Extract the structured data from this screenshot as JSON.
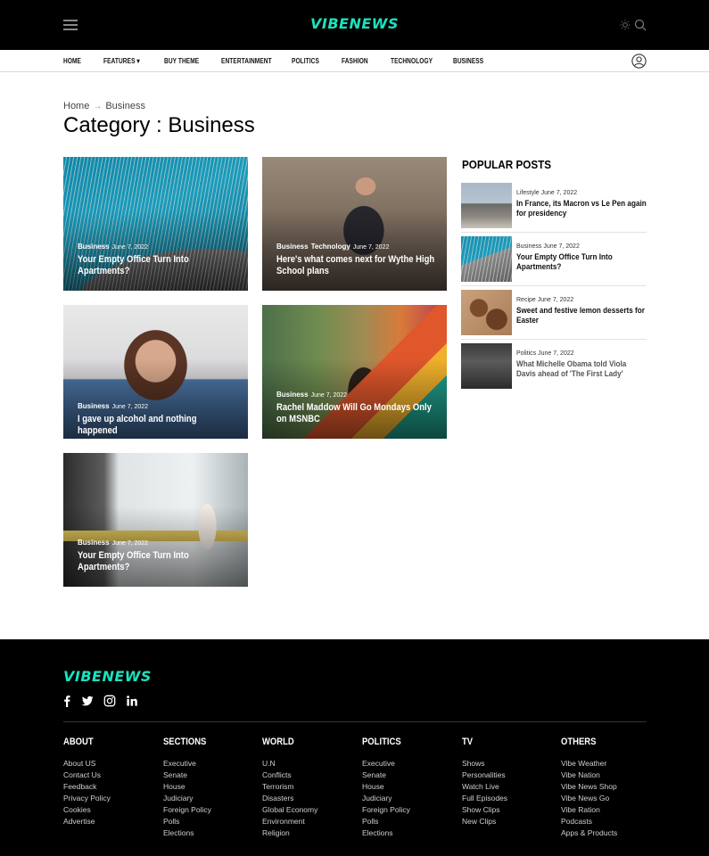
{
  "header": {
    "logo": "VIBENEWS",
    "nav": [
      "HOME",
      "FEATURES ▾",
      "BUY THEME",
      "ENTERTAINMENT",
      "POLITICS",
      "FASHION",
      "TECHNOLOGY",
      "BUSINESS"
    ]
  },
  "breadcrumb": {
    "home": "Home",
    "separator": "→",
    "current": "Business"
  },
  "page_title": "Category : Business",
  "cards": [
    {
      "categories": [
        "Business"
      ],
      "date": "June 7, 2022",
      "title": "Your Empty Office Turn Into Apartments?",
      "image": "building-facade"
    },
    {
      "categories": [
        "Business",
        "Technology"
      ],
      "date": "June 7, 2022",
      "title": "Here's what comes next for Wythe High School plans",
      "image": "speaker-podium"
    },
    {
      "categories": [
        "Business"
      ],
      "date": "June 7, 2022",
      "title": "I gave up alcohol and nothing happened",
      "image": "woman-peace-signs"
    },
    {
      "categories": [
        "Business"
      ],
      "date": "June 7, 2022",
      "title": "Rachel Maddow Will Go Mondays Only on MSNBC",
      "image": "woman-mural-wall"
    },
    {
      "categories": [
        "Business"
      ],
      "date": "June 7, 2022",
      "title": "Your Empty Office Turn Into Apartments?",
      "image": "office-meeting"
    }
  ],
  "sidebar": {
    "heading": "POPULAR POSTS",
    "posts": [
      {
        "category": "Lifestyle",
        "date": "June 7, 2022",
        "title": "In France, its Macron vs Le Pen again for presidency",
        "image": "louvre"
      },
      {
        "category": "Business",
        "date": "June 7, 2022",
        "title": "Your Empty Office Turn Into Apartments?",
        "image": "building-facade"
      },
      {
        "category": "Recipe",
        "date": "June 7, 2022",
        "title": "Sweet and festive lemon desserts for Easter",
        "image": "cookies"
      },
      {
        "category": "Politics",
        "date": "June 7, 2022",
        "title": "What Michelle Obama told Viola Davis ahead of 'The First Lady'",
        "image": "group-photo"
      }
    ]
  },
  "footer": {
    "logo": "VIBENEWS",
    "social": [
      "facebook-icon",
      "twitter-icon",
      "instagram-icon",
      "linkedin-icon"
    ],
    "columns": [
      {
        "heading": "ABOUT",
        "links": [
          "About US",
          "Contact Us",
          "Feedback",
          "Privacy Policy",
          "Cookies",
          "Advertise"
        ]
      },
      {
        "heading": "SECTIONS",
        "links": [
          "Executive",
          "Senate",
          "House",
          "Judiciary",
          "Foreign Policy",
          "Polls",
          "Elections"
        ]
      },
      {
        "heading": "WORLD",
        "links": [
          "U.N",
          "Conflicts",
          "Terrorism",
          "Disasters",
          "Global Economy",
          "Environment",
          "Religion"
        ]
      },
      {
        "heading": "POLITICS",
        "links": [
          "Executive",
          "Senate",
          "House",
          "Judiciary",
          "Foreign Policy",
          "Polls",
          "Elections"
        ]
      },
      {
        "heading": "TV",
        "links": [
          "Shows",
          "Personalities",
          "Watch Live",
          "Full Episodes",
          "Show Clips",
          "New Clips"
        ]
      },
      {
        "heading": "OTHERS",
        "links": [
          "Vibe Weather",
          "Vibe Nation",
          "Vibe News Shop",
          "Vibe News Go",
          "Vibe Ration",
          "Podcasts",
          "Apps & Products"
        ]
      }
    ]
  },
  "colors": {
    "brand": "#19e3bf",
    "header_bg": "#000000",
    "footer_bg": "#000000"
  }
}
